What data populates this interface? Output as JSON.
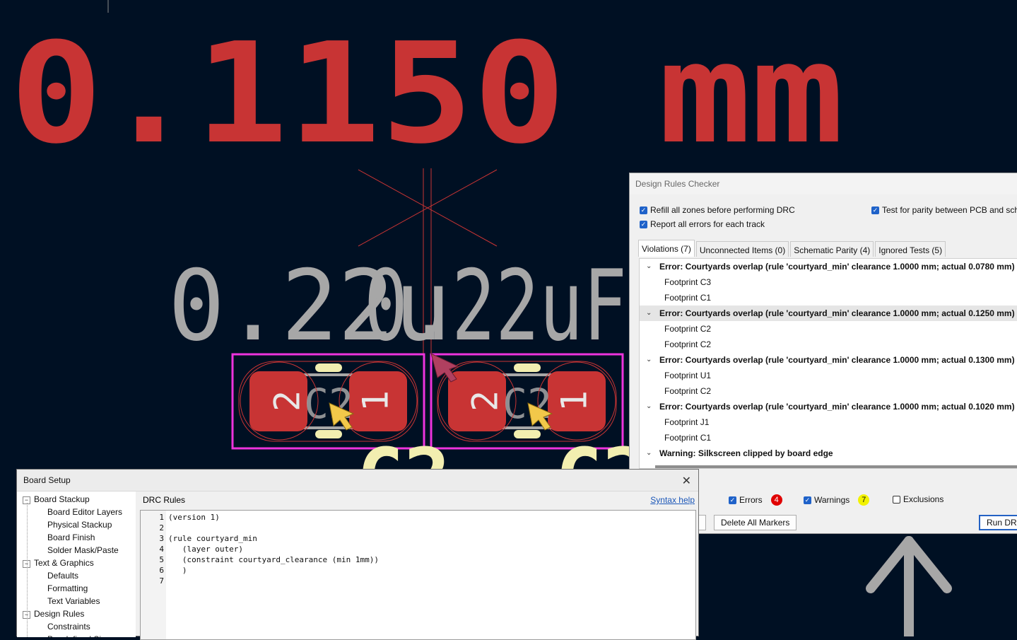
{
  "pcb": {
    "dimension_text": "0.1150 mm",
    "value_text_left": "0.22u",
    "value_text_right": "0.22uF",
    "ref_left": "C2",
    "ref_right": "C2",
    "pad_left_1": "2",
    "pad_left_2": "1",
    "pad_right_1": "2",
    "pad_right_2": "1",
    "bottom_ref_left": "C2",
    "bottom_ref_right": "C2"
  },
  "drc": {
    "title": "Design Rules Checker",
    "opt_refill": "Refill all zones before performing DRC",
    "opt_report_all": "Report all errors for each track",
    "opt_parity": "Test for parity between PCB and sche",
    "tabs": [
      "Violations (7)",
      "Unconnected Items (0)",
      "Schematic Parity (4)",
      "Ignored Tests (5)"
    ],
    "violations": [
      {
        "kind": "err",
        "text": "Error: Courtyards overlap (rule 'courtyard_min' clearance 1.0000 mm; actual 0.0780 mm)"
      },
      {
        "kind": "item",
        "text": "Footprint C3"
      },
      {
        "kind": "item",
        "text": "Footprint C1"
      },
      {
        "kind": "err",
        "text": "Error: Courtyards overlap (rule 'courtyard_min' clearance 1.0000 mm; actual 0.1250 mm)",
        "selected": true
      },
      {
        "kind": "item",
        "text": "Footprint C2"
      },
      {
        "kind": "item",
        "text": "Footprint C2"
      },
      {
        "kind": "err",
        "text": "Error: Courtyards overlap (rule 'courtyard_min' clearance 1.0000 mm; actual 0.1300 mm)"
      },
      {
        "kind": "item",
        "text": "Footprint U1"
      },
      {
        "kind": "item",
        "text": "Footprint C2"
      },
      {
        "kind": "err",
        "text": "Error: Courtyards overlap (rule 'courtyard_min' clearance 1.0000 mm; actual 0.1020 mm)"
      },
      {
        "kind": "item",
        "text": "Footprint J1"
      },
      {
        "kind": "item",
        "text": "Footprint C1"
      },
      {
        "kind": "err",
        "text": "Warning: Silkscreen clipped by board edge"
      }
    ],
    "filter_errors": "Errors",
    "errors_count": "4",
    "filter_warnings": "Warnings",
    "warnings_count": "7",
    "filter_exclusions": "Exclusions",
    "delete_all_markers": "Delete All Markers",
    "run_drc": "Run DRC",
    "colors": {
      "errors_badge": "#e00000",
      "warnings_badge": "#f2f200"
    }
  },
  "setup": {
    "title": "Board Setup",
    "close_glyph": "✕",
    "tree": [
      {
        "label": "Board Stackup",
        "level": 0,
        "expander": "−"
      },
      {
        "label": "Board Editor Layers",
        "level": 1
      },
      {
        "label": "Physical Stackup",
        "level": 1
      },
      {
        "label": "Board Finish",
        "level": 1
      },
      {
        "label": "Solder Mask/Paste",
        "level": 1
      },
      {
        "label": "Text & Graphics",
        "level": 0,
        "expander": "−"
      },
      {
        "label": "Defaults",
        "level": 1
      },
      {
        "label": "Formatting",
        "level": 1
      },
      {
        "label": "Text Variables",
        "level": 1
      },
      {
        "label": "Design Rules",
        "level": 0,
        "expander": "−"
      },
      {
        "label": "Constraints",
        "level": 1
      },
      {
        "label": "Pre-defined Sizes",
        "level": 1
      }
    ],
    "panel_title": "DRC Rules",
    "syntax_help": "Syntax help",
    "code_lines": [
      "(version 1)",
      "",
      "(rule courtyard_min",
      "   (layer outer)",
      "   (constraint courtyard_clearance (min 1mm))",
      "   )",
      ""
    ]
  }
}
